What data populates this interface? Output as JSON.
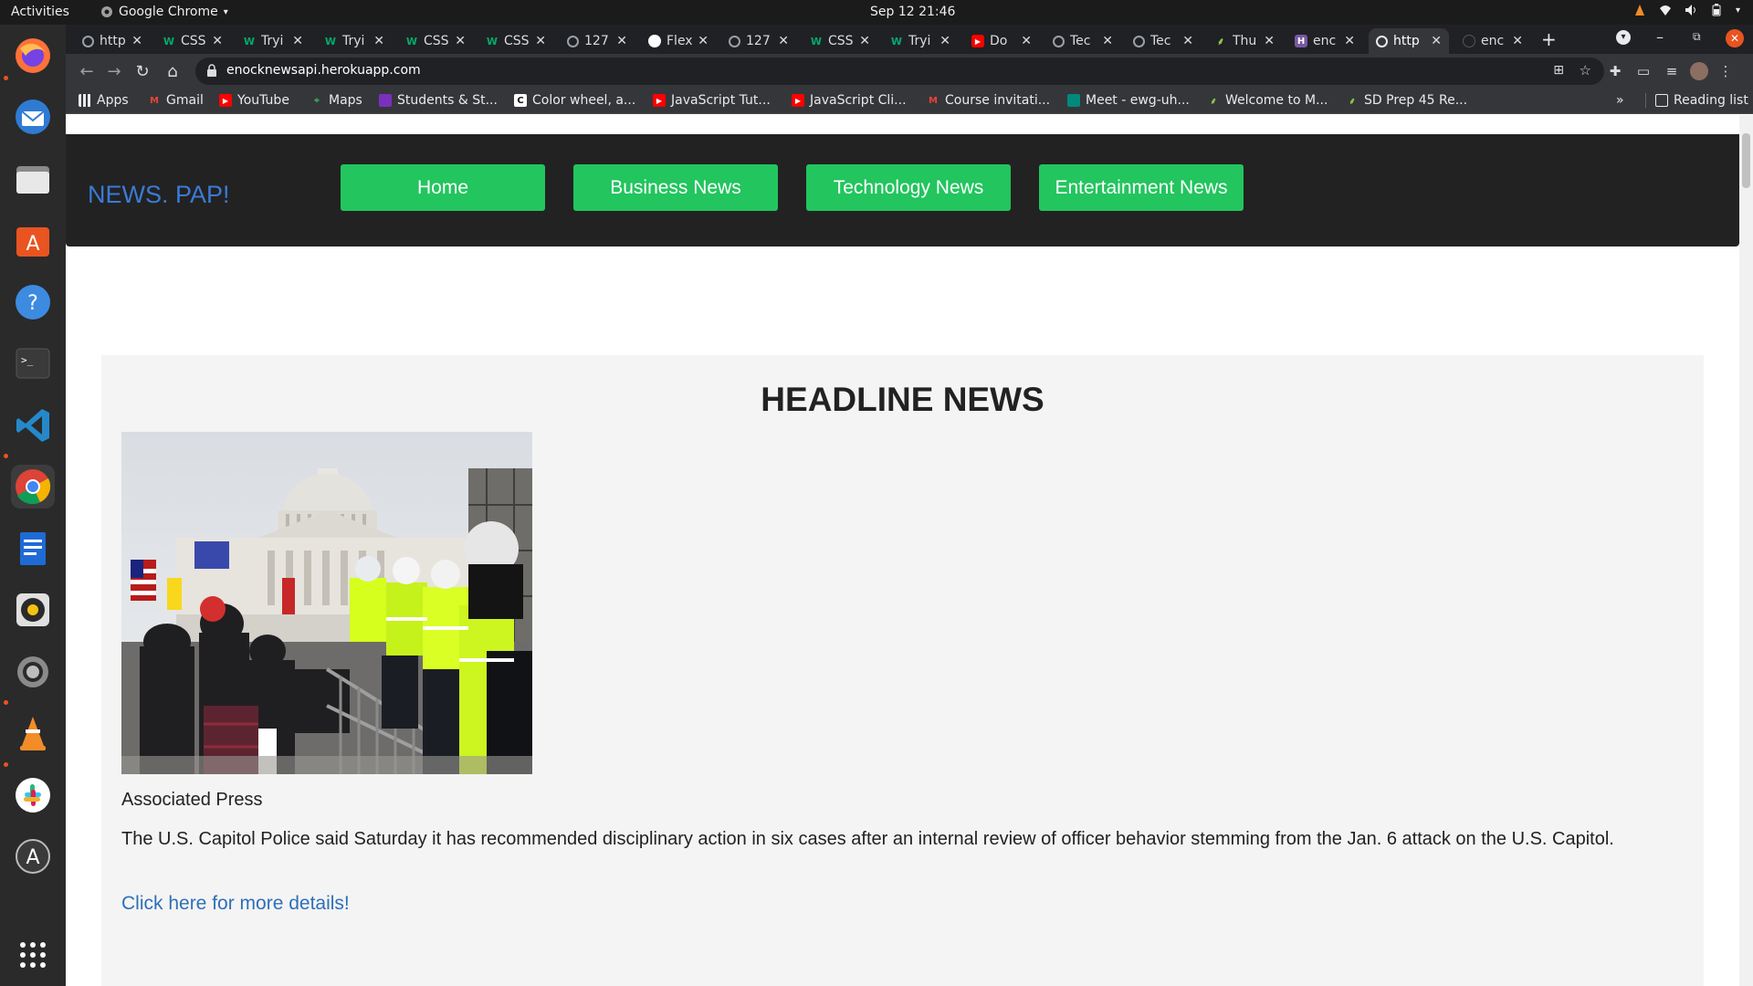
{
  "system": {
    "activities": "Activities",
    "app_name": "Google Chrome",
    "clock": "Sep 12  21:46"
  },
  "dock": {
    "items": [
      "firefox-icon",
      "thunderbird-icon",
      "files-icon",
      "software-center-icon",
      "help-icon",
      "terminal-icon",
      "vscode-icon",
      "chrome-icon",
      "writer-icon",
      "rhythmbox-icon",
      "settings-icon",
      "vlc-icon",
      "slack-icon",
      "updater-icon",
      "show-apps-icon"
    ]
  },
  "browser": {
    "tabs": [
      {
        "label": "http",
        "icon": "globe-icon"
      },
      {
        "label": "CSS",
        "icon": "w3schools-icon"
      },
      {
        "label": "Tryi",
        "icon": "w3schools-icon"
      },
      {
        "label": "Tryi",
        "icon": "w3schools-icon"
      },
      {
        "label": "CSS",
        "icon": "w3schools-icon"
      },
      {
        "label": "CSS",
        "icon": "w3schools-icon"
      },
      {
        "label": "127",
        "icon": "globe-icon"
      },
      {
        "label": "Flex",
        "icon": "flexbox-icon"
      },
      {
        "label": "127",
        "icon": "globe-icon"
      },
      {
        "label": "CSS",
        "icon": "w3schools-icon"
      },
      {
        "label": "Tryi",
        "icon": "w3schools-icon"
      },
      {
        "label": "Do",
        "icon": "youtube-icon"
      },
      {
        "label": "Tec",
        "icon": "globe-icon"
      },
      {
        "label": "Tec",
        "icon": "globe-icon"
      },
      {
        "label": "Thu",
        "icon": "palm-icon"
      },
      {
        "label": "enc",
        "icon": "heroku-icon"
      },
      {
        "label": "http",
        "icon": "globe-icon"
      },
      {
        "label": "enc",
        "icon": "github-icon"
      }
    ],
    "url": "enocknewsapi.herokuapp.com",
    "bookmarks": [
      {
        "label": "Apps",
        "icon": "apps-grid-icon"
      },
      {
        "label": "Gmail",
        "icon": "gmail-icon"
      },
      {
        "label": "YouTube",
        "icon": "youtube-icon"
      },
      {
        "label": "Maps",
        "icon": "maps-icon"
      },
      {
        "label": "Students & St...",
        "icon": "students-icon"
      },
      {
        "label": "Color wheel, a...",
        "icon": "color-wheel-icon"
      },
      {
        "label": "JavaScript Tut...",
        "icon": "youtube-icon"
      },
      {
        "label": "JavaScript Cli...",
        "icon": "youtube-icon"
      },
      {
        "label": "Course invitati...",
        "icon": "gmail-icon"
      },
      {
        "label": "Meet - ewg-uh...",
        "icon": "meet-icon"
      },
      {
        "label": "Welcome to M...",
        "icon": "palm-icon"
      },
      {
        "label": "SD Prep 45 Re...",
        "icon": "palm-icon"
      }
    ],
    "more": "»",
    "reading_list": "Reading list"
  },
  "site": {
    "brand": "NEWS. PAP!",
    "nav": [
      "Home",
      "Business News",
      "Technology News",
      "Entertainment News"
    ],
    "headline": {
      "title": "HEADLINE NEWS",
      "source": "Associated Press",
      "description": "The U.S. Capitol Police said Saturday it has recommended disciplinary action in six cases after an internal review of officer behavior stemming from the Jan. 6 attack on the U.S. Capitol.",
      "link_text": "Click here for more details!"
    }
  }
}
